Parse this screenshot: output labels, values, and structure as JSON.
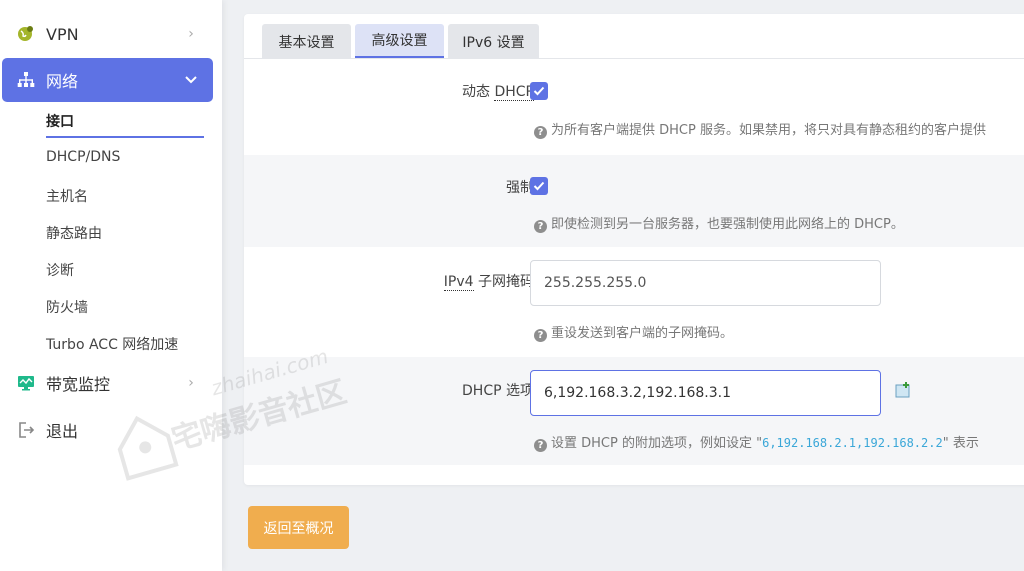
{
  "sidebar": {
    "vpn_label": "VPN",
    "network_label": "网络",
    "sub_items": [
      "接口",
      "DHCP/DNS",
      "主机名",
      "静态路由",
      "诊断",
      "防火墙",
      "Turbo ACC 网络加速"
    ],
    "bandwidth_label": "带宽监控",
    "logout_label": "退出"
  },
  "tabs": [
    "基本设置",
    "高级设置",
    "IPv6 设置"
  ],
  "form": {
    "dynamic_dhcp": {
      "label_prefix": "动态 ",
      "label_abbr": "DHCP",
      "checked": true,
      "help": "为所有客户端提供 DHCP 服务。如果禁用，将只对具有静态租约的客户提供"
    },
    "force": {
      "label": "强制",
      "checked": true,
      "help": "即使检测到另一台服务器，也要强制使用此网络上的 DHCP。"
    },
    "netmask": {
      "label_abbr": "IPv4",
      "label_suffix": " 子网掩码",
      "value": "255.255.255.0",
      "help": "重设发送到客户端的子网掩码。"
    },
    "dhcp_options": {
      "label": "DHCP 选项",
      "value": "6,192.168.3.2,192.168.3.1",
      "help_prefix": "设置 DHCP 的附加选项，例如设定 \"",
      "help_code": "6,192.168.2.1,192.168.2.2",
      "help_suffix": "\" 表示"
    }
  },
  "back_button": "返回至概况",
  "watermark": {
    "sub": "zhaihai.com",
    "main": "宅嗨影音社区"
  },
  "colors": {
    "accent": "#5e72e4",
    "warning": "#f0ad4e"
  }
}
